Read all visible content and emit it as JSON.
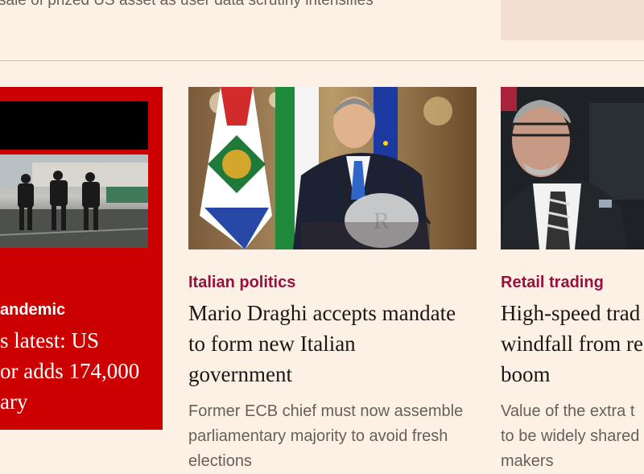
{
  "top": {
    "snippet": "sale of prized US asset as user data scrutiny intensifies"
  },
  "cards": [
    {
      "kicker": "andemic",
      "headline": "s latest: US\nor adds 174,000\nary"
    },
    {
      "kicker": "Italian politics",
      "headline": "Mario Draghi accepts mandate\nto form new Italian\ngovernment",
      "standfirst": "Former ECB chief must now assemble\nparliamentary majority to avoid fresh\nelections"
    },
    {
      "kicker": "Retail trading",
      "headline": "High-speed trad\nwindfall from re\nboom",
      "standfirst": "Value of the extra t\nto be widely shared\nmakers"
    }
  ],
  "colors": {
    "background": "#fdf1e5",
    "kicker": "#990f3d",
    "red_card": "#cc0000"
  }
}
